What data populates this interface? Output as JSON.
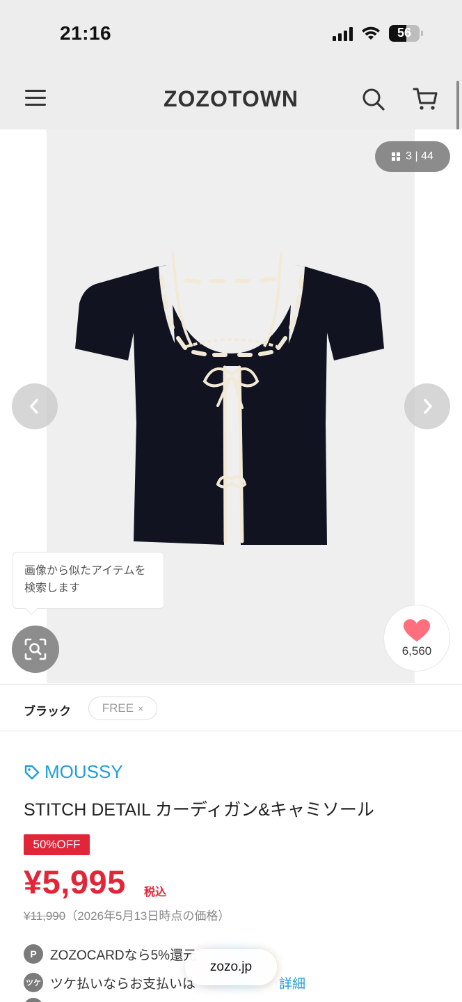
{
  "status_bar": {
    "time": "21:16",
    "battery": "56",
    "battery_level": 0.56
  },
  "header": {
    "logo": "ZOZOTOWN",
    "icons": [
      "menu-icon",
      "search-icon",
      "cart-icon"
    ]
  },
  "gallery": {
    "counter": "3 | 44",
    "current_index": 3,
    "total": 44,
    "image_search_hint_line1": "画像から似たアイテムを",
    "image_search_hint_line2": "検索します",
    "favorite_count": "6,560",
    "colors": {
      "heart": "#ff6f7d",
      "garment": "#111320",
      "trim": "#f2ead6"
    }
  },
  "variants": {
    "color": "ブラック",
    "size": "FREE",
    "size_remove": "×"
  },
  "product": {
    "brand": "MOUSSY",
    "title": "STITCH DETAIL カーディガン&キャミソール",
    "discount_badge": "50%OFF",
    "price": "¥5,995",
    "tax_label": "税込",
    "original_price": "¥11,990",
    "price_note": "（2026年5月13日時点の価格）"
  },
  "benefits": [
    {
      "icon": "P",
      "text": "ZOZOCARDなら5%還元"
    },
    {
      "icon": "ツケ",
      "text": "ツケ払いならお支払いは",
      "link": "詳細"
    }
  ],
  "browser": {
    "url": "zozo.jp"
  },
  "colors": {
    "accent": "#1f9ed8",
    "sale": "#e2263a",
    "header_bg": "#ededed"
  }
}
